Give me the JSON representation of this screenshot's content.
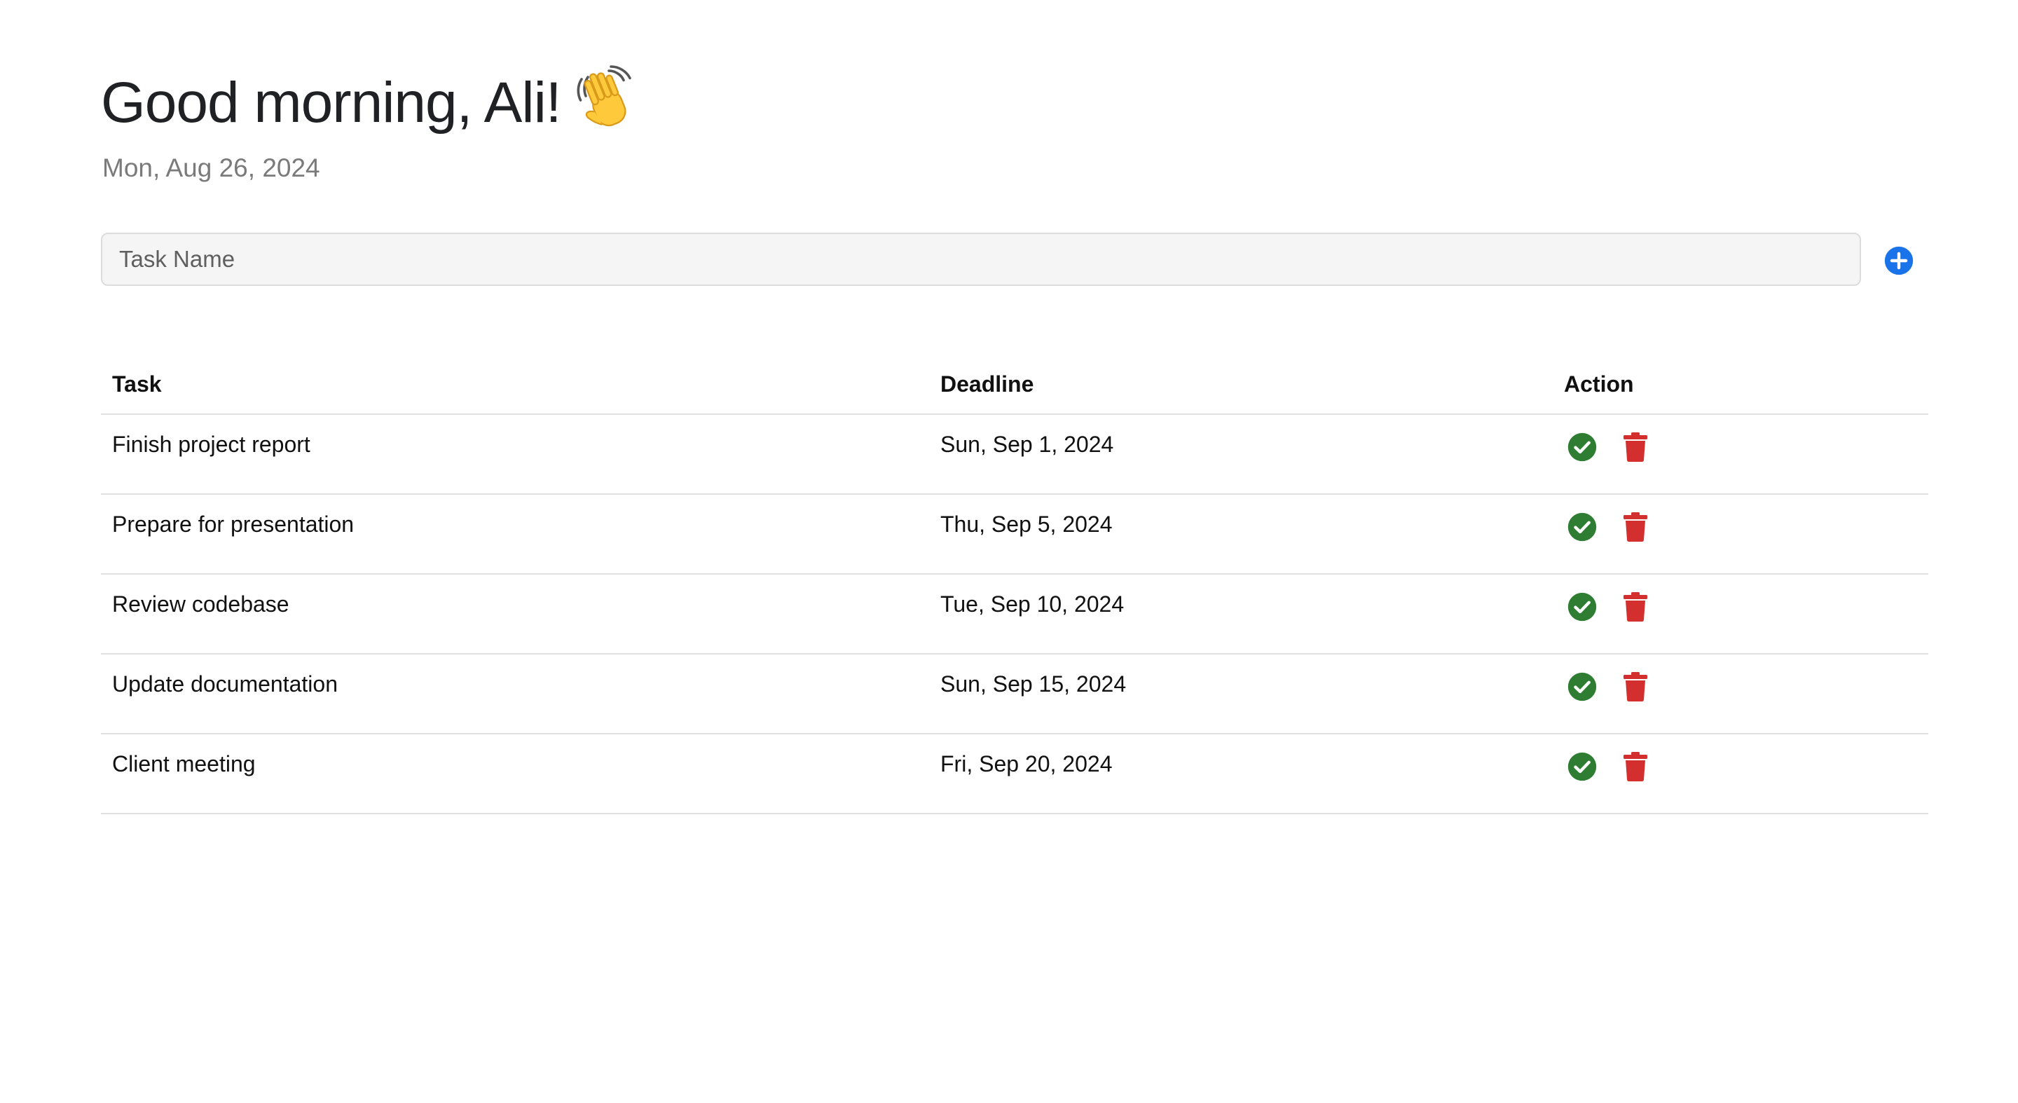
{
  "header": {
    "greeting": "Good morning, Ali!",
    "greeting_icon": "waving-hand-icon",
    "date": "Mon, Aug 26, 2024"
  },
  "add_task": {
    "placeholder": "Task Name",
    "value": "",
    "add_icon": "plus-circle-icon"
  },
  "table": {
    "columns": [
      "Task",
      "Deadline",
      "Action"
    ],
    "rows": [
      {
        "task": "Finish project report",
        "deadline": "Sun, Sep 1, 2024"
      },
      {
        "task": "Prepare for presentation",
        "deadline": "Thu, Sep 5, 2024"
      },
      {
        "task": "Review codebase",
        "deadline": "Tue, Sep 10, 2024"
      },
      {
        "task": "Update documentation",
        "deadline": "Sun, Sep 15, 2024"
      },
      {
        "task": "Client meeting",
        "deadline": "Fri, Sep 20, 2024"
      }
    ],
    "action_icons": [
      "check-circle-icon",
      "trash-icon"
    ]
  },
  "colors": {
    "accent_blue": "#1a73e8",
    "complete_green": "#2e7d32",
    "delete_red": "#d32f2f"
  }
}
